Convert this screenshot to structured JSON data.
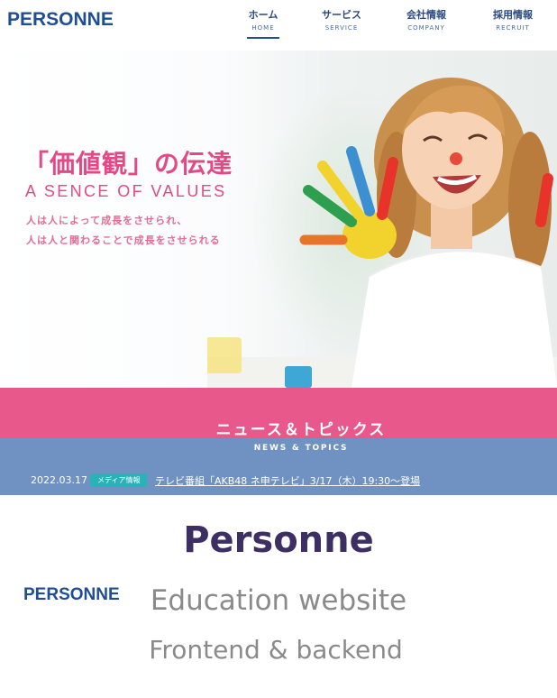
{
  "header": {
    "logo": "PERSONNE",
    "nav": [
      {
        "jp": "ホーム",
        "en": "HOME",
        "active": true
      },
      {
        "jp": "サービス",
        "en": "SERVICE",
        "active": false
      },
      {
        "jp": "会社情報",
        "en": "COMPANY",
        "active": false
      },
      {
        "jp": "採用情報",
        "en": "RECRUIT",
        "active": false
      }
    ]
  },
  "hero": {
    "title_jp": "「価値観」の伝達",
    "title_en": "A SENCE OF VALUES",
    "sub_line1": "人は人によって成長をさせられ、",
    "sub_line2": "人は人と関わることで成長をさせられる"
  },
  "news": {
    "title": "ニュース＆トピックス",
    "subtitle": "NEWS & TOPICS",
    "items": [
      {
        "date": "2022.03.17",
        "category": "メディア情報",
        "text": "テレビ番組「AKB48 ネ申テレビ」3/17（木）19:30～登場"
      }
    ]
  },
  "caption": {
    "title": "Personne",
    "logo": "PERSONNE",
    "line1": "Education website",
    "line2": "Frontend & backend"
  },
  "colors": {
    "brand_blue": "#1f4e95",
    "accent_pink": "#e8588a",
    "news_blue": "#6f92c2",
    "badge_teal": "#27b3b8"
  }
}
